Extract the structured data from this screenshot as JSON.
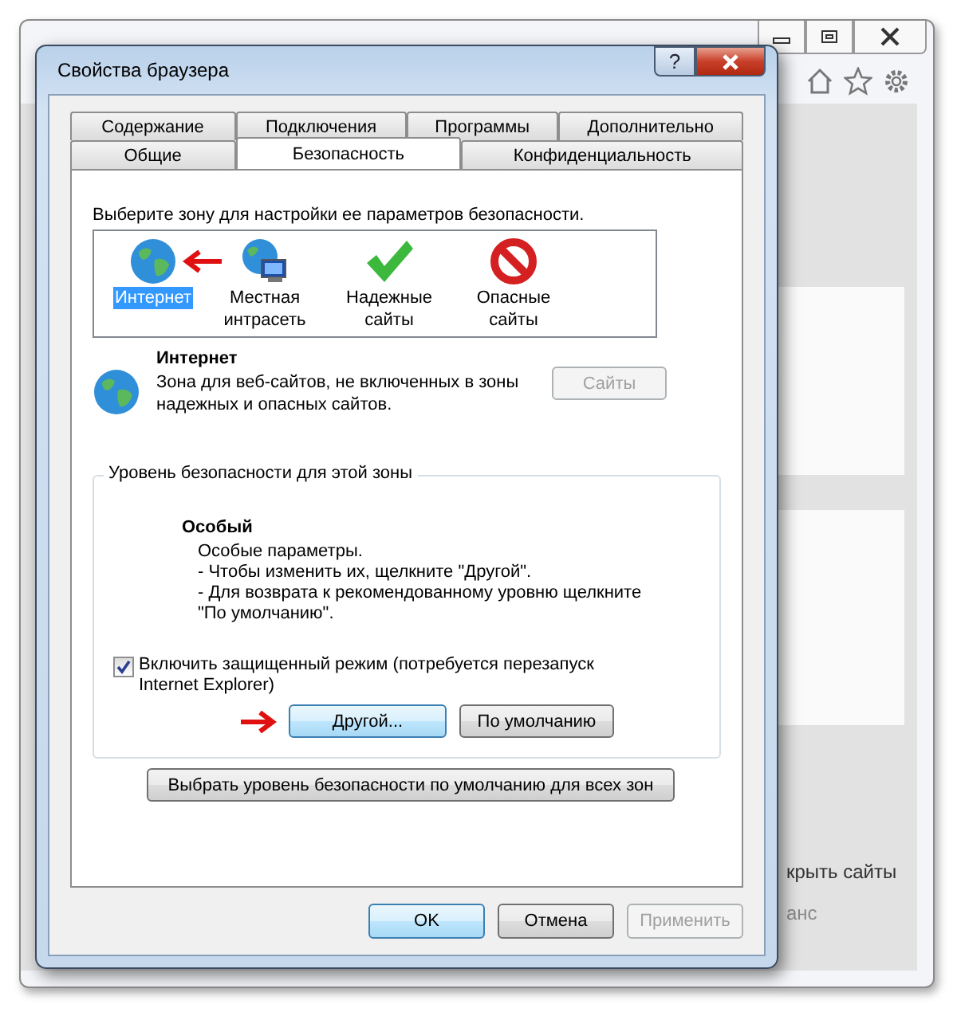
{
  "browser": {
    "texts": [
      {
        "text": "крыть сайты",
        "disabled": false
      },
      {
        "text": "анс",
        "disabled": true
      }
    ]
  },
  "dialog": {
    "title": "Свойства браузера",
    "help": "?",
    "tabs": [
      [
        {
          "label": "Содержание",
          "selected": false
        },
        {
          "label": "Подключения",
          "selected": false
        },
        {
          "label": "Программы",
          "selected": false
        },
        {
          "label": "Дополнительно",
          "selected": false
        }
      ],
      [
        {
          "label": "Общие",
          "selected": false
        },
        {
          "label": "Безопасность",
          "selected": true
        },
        {
          "label": "Конфиденциальность",
          "selected": false
        }
      ]
    ],
    "zones_prompt": "Выберите зону для настройки ее параметров безопасности.",
    "zones": [
      {
        "label": "Интернет",
        "kind": "globe",
        "selected": true
      },
      {
        "label": "Местная интрасеть",
        "kind": "intranet",
        "selected": false
      },
      {
        "label": "Надежные сайты",
        "kind": "check",
        "selected": false
      },
      {
        "label": "Опасные сайты",
        "kind": "block",
        "selected": false
      }
    ],
    "zone_info": {
      "title": "Интернет",
      "description": "Зона для веб-сайтов, не включенных в зоны надежных и опасных сайтов.",
      "sites_button": {
        "label": "Сайты",
        "disabled": true
      }
    },
    "level_group": {
      "legend": "Уровень безопасности для этой зоны",
      "level_name": "Особый",
      "lines": [
        "Особые параметры.",
        "- Чтобы изменить их, щелкните \"Другой\".",
        "- Для возврата к рекомендованному уровню щелкните \"По умолчанию\"."
      ],
      "protected_mode": {
        "label": "Включить защищенный режим (потребуется перезапуск Internet Explorer)",
        "checked": true
      },
      "buttons": [
        {
          "label": "Другой...",
          "focused": true
        },
        {
          "label": "По умолчанию",
          "focused": false
        }
      ]
    },
    "default_all_button": "Выбрать уровень безопасности по умолчанию для всех зон",
    "footer_buttons": [
      {
        "label": "OK",
        "focused": true,
        "disabled": false
      },
      {
        "label": "Отмена",
        "focused": false,
        "disabled": false
      },
      {
        "label": "Применить",
        "focused": false,
        "disabled": true
      }
    ]
  }
}
